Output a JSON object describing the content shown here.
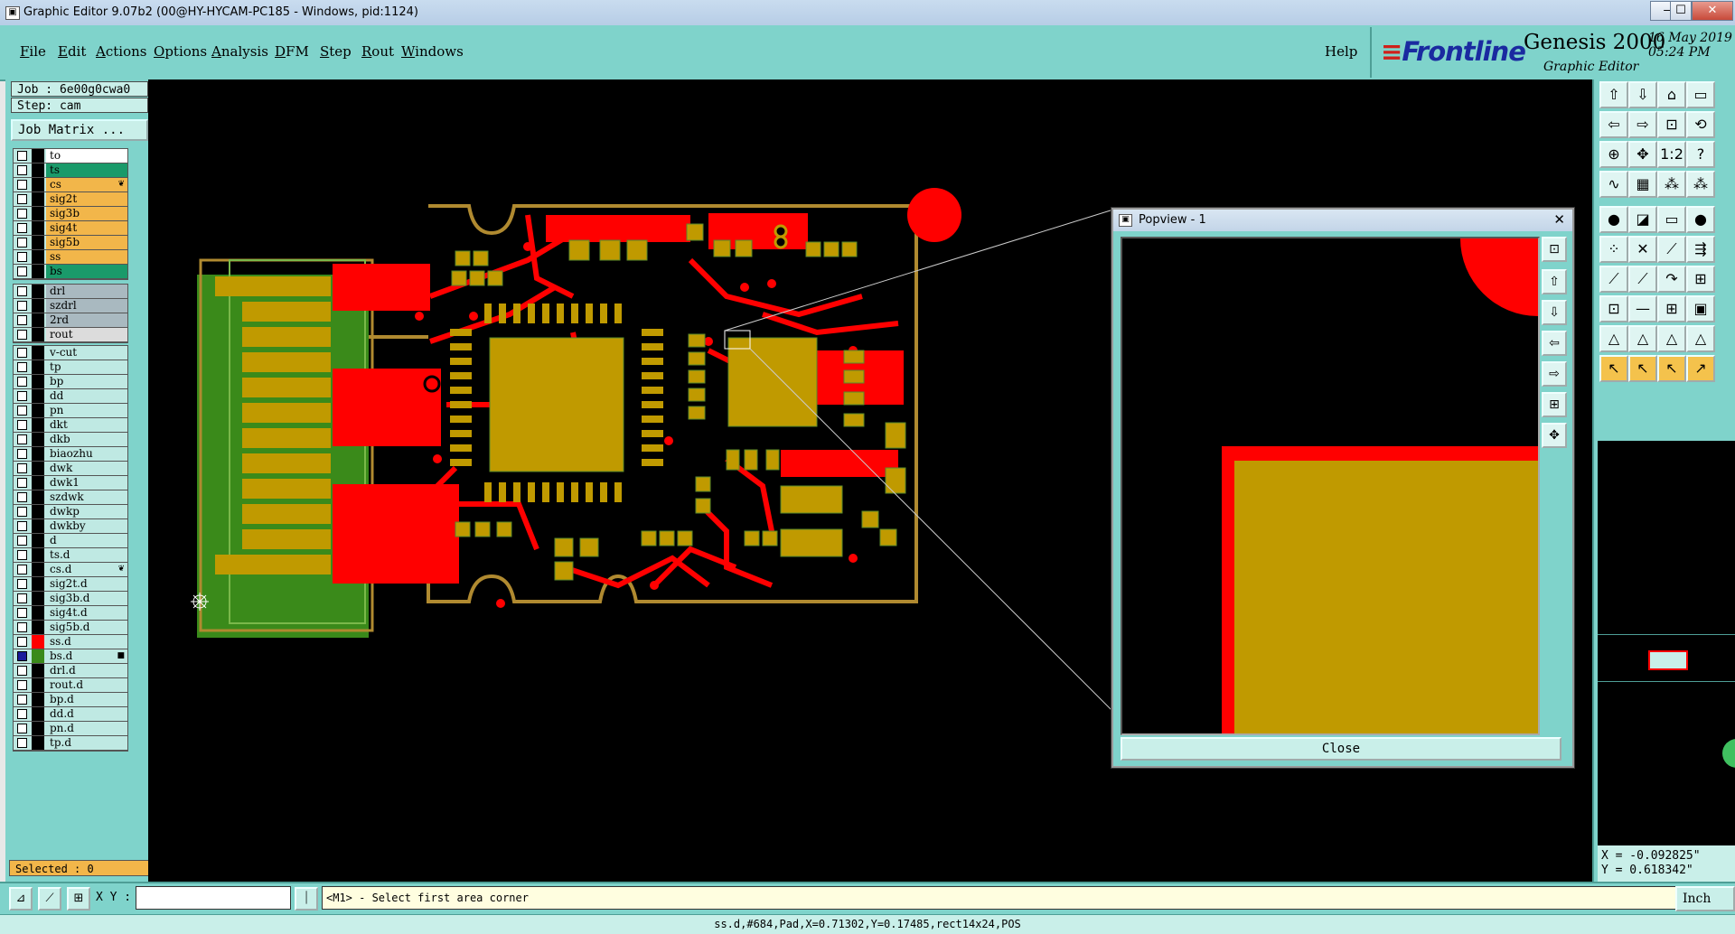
{
  "window": {
    "title": "Graphic Editor 9.07b2 (00@HY-HYCAM-PC185 - Windows, pid:1124)",
    "minimize_glyph": "—",
    "maximize_glyph": "☐",
    "close_glyph": "✕"
  },
  "menu": {
    "items": [
      {
        "first": "F",
        "rest": "ile"
      },
      {
        "first": "E",
        "rest": "dit"
      },
      {
        "first": "A",
        "rest": "ctions"
      },
      {
        "first": "O",
        "rest": "ptions"
      },
      {
        "first": "A",
        "rest": "nalysis"
      },
      {
        "first": "D",
        "rest": "FM"
      },
      {
        "first": "S",
        "rest": "tep"
      },
      {
        "first": "R",
        "rest": "out"
      },
      {
        "first": "W",
        "rest": "indows"
      }
    ],
    "help": "Help"
  },
  "brand": {
    "logo_main": "Frontline",
    "logo_mark": "≡",
    "product": "Genesis 2000",
    "subtitle": "Graphic Editor",
    "date": "16 May 2019",
    "time": "05:24 PM"
  },
  "job": {
    "job_line": "Job : 6e00g0cwa0",
    "step_line": "Step: cam",
    "matrix_button": "Job Matrix ..."
  },
  "layers": {
    "group1": [
      {
        "name": "to",
        "color": "#ffffff"
      },
      {
        "name": "ts",
        "color": "#1a9a6a"
      },
      {
        "name": "cs",
        "color": "#f2b64a",
        "mark": "❦"
      },
      {
        "name": "sig2t",
        "color": "#f2b64a"
      },
      {
        "name": "sig3b",
        "color": "#f2b64a"
      },
      {
        "name": "sig4t",
        "color": "#f2b64a"
      },
      {
        "name": "sig5b",
        "color": "#f2b64a"
      },
      {
        "name": "ss",
        "color": "#f2b64a"
      },
      {
        "name": "bs",
        "color": "#1a9a6a"
      }
    ],
    "group2": [
      {
        "name": "drl",
        "color": "#a9b9c0"
      },
      {
        "name": "szdrl",
        "color": "#a9b9c0"
      },
      {
        "name": "2rd",
        "color": "#a9b9c0"
      },
      {
        "name": "rout",
        "color": "#dcdcdc"
      }
    ],
    "group3": [
      {
        "name": "v-cut",
        "color": "#bfe9e3"
      },
      {
        "name": "tp",
        "color": "#bfe9e3"
      },
      {
        "name": "bp",
        "color": "#bfe9e3"
      },
      {
        "name": "dd",
        "color": "#bfe9e3"
      },
      {
        "name": "pn",
        "color": "#bfe9e3"
      },
      {
        "name": "dkt",
        "color": "#bfe9e3"
      },
      {
        "name": "dkb",
        "color": "#bfe9e3"
      },
      {
        "name": "biaozhu",
        "color": "#bfe9e3"
      },
      {
        "name": "dwk",
        "color": "#bfe9e3"
      },
      {
        "name": "dwk1",
        "color": "#bfe9e3"
      },
      {
        "name": "szdwk",
        "color": "#bfe9e3"
      },
      {
        "name": "dwkp",
        "color": "#bfe9e3"
      },
      {
        "name": "dwkby",
        "color": "#bfe9e3"
      },
      {
        "name": "d",
        "color": "#bfe9e3"
      },
      {
        "name": "ts.d",
        "color": "#bfe9e3"
      },
      {
        "name": "cs.d",
        "color": "#bfe9e3",
        "mark": "❦"
      },
      {
        "name": "sig2t.d",
        "color": "#bfe9e3"
      },
      {
        "name": "sig3b.d",
        "color": "#bfe9e3"
      },
      {
        "name": "sig4t.d",
        "color": "#bfe9e3"
      },
      {
        "name": "sig5b.d",
        "color": "#bfe9e3"
      },
      {
        "name": "ss.d",
        "color": "#bfe9e3",
        "swatch": "#ff0000"
      },
      {
        "name": "bs.d",
        "color": "#bfe9e3",
        "swatch": "#3a8a1a",
        "checked": true,
        "mark": "■"
      },
      {
        "name": "drl.d",
        "color": "#bfe9e3"
      },
      {
        "name": "rout.d",
        "color": "#bfe9e3"
      },
      {
        "name": "bp.d",
        "color": "#bfe9e3"
      },
      {
        "name": "dd.d",
        "color": "#bfe9e3"
      },
      {
        "name": "pn.d",
        "color": "#bfe9e3"
      },
      {
        "name": "tp.d",
        "color": "#bfe9e3"
      }
    ]
  },
  "selected": "Selected : 0",
  "popview": {
    "title": "Popview - 1",
    "close_glyph": "✕",
    "close_button": "Close"
  },
  "coordinates": {
    "x": "X = -0.092825\"",
    "y": "Y =  0.618342\""
  },
  "bottom": {
    "xy_label": "X Y :",
    "xy_value": "",
    "prompt": "<M1> - Select first area corner",
    "unit": "Inch"
  },
  "status": "ss.d,#684,Pad,X=0.71302,Y=0.17485,rect14x24,POS",
  "colors": {
    "panel": "#7fd3cb",
    "copper": "#ff0000",
    "pad": "#c09a00",
    "board": "#3a8a1a",
    "outline": "#b08a30"
  },
  "right_tools": [
    "layer-up-icon",
    "layer-down-icon",
    "home-icon",
    "window-icon",
    "zoom-prev-icon",
    "zoom-next-icon",
    "zoom-fit-icon",
    "redraw-icon",
    "zoom-in-icon",
    "pan-icon",
    "ratio-icon",
    "help-icon",
    "snap-icon",
    "grid-icon",
    "ddr-icon",
    "ddr-alt-icon",
    "add-pad-icon",
    "add-line-icon",
    "add-text-icon",
    "add-circle-icon",
    "net-icon",
    "cross-icon",
    "route-icon",
    "connect-icon",
    "measure-icon",
    "line-tool-icon",
    "arc-icon",
    "fill-icon",
    "pad-tool-icon",
    "dim-icon",
    "segment-icon",
    "surface-icon",
    "triangle-icon",
    "triangle-fill-icon",
    "triangle-alt-icon",
    "triangle-edge-icon",
    "select-icon",
    "select-add-icon",
    "select-move-icon",
    "select-snap-icon"
  ]
}
